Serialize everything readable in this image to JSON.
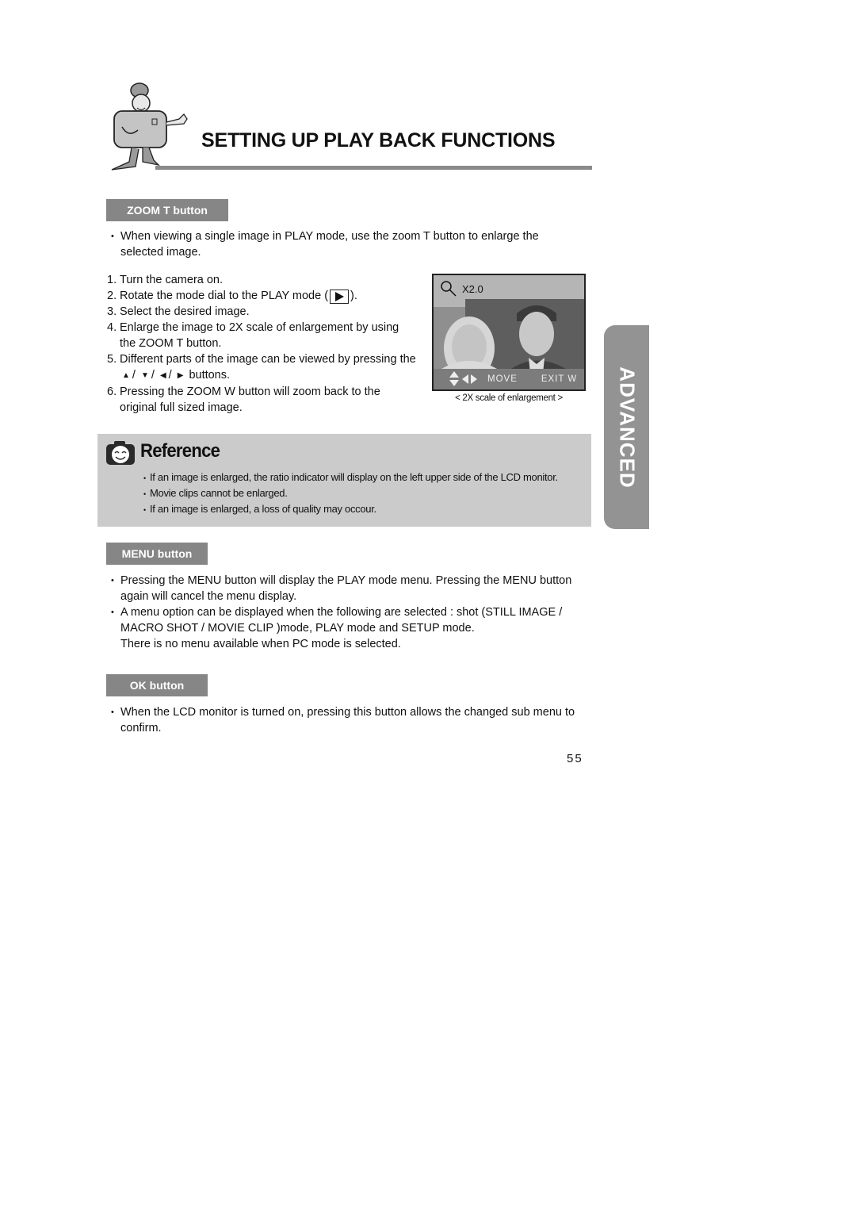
{
  "header": {
    "title": "SETTING UP PLAY BACK FUNCTIONS",
    "mascot_icon": "camera-mascot-icon"
  },
  "zoom_t": {
    "tag": "ZOOM T button",
    "intro_line1": "When viewing a single image in PLAY mode, use the zoom T button to enlarge the",
    "intro_line2": "selected image.",
    "steps": [
      {
        "num": "1.",
        "lines": [
          "Turn the camera on."
        ]
      },
      {
        "num": "2.",
        "pre": "Rotate the mode dial to the PLAY mode (",
        "post": ")."
      },
      {
        "num": "3.",
        "lines": [
          "Select the desired image."
        ]
      },
      {
        "num": "4.",
        "lines": [
          "Enlarge the image to 2X scale of enlargement by using",
          "the ZOOM T button."
        ]
      },
      {
        "num": "5.",
        "lines": [
          "Different parts of the image can be viewed by pressing the"
        ],
        "arrows_suffix": "buttons."
      },
      {
        "num": "6.",
        "lines": [
          "Pressing the ZOOM W button will zoom back to the",
          "original full sized image."
        ]
      }
    ],
    "arrow_separator": "/",
    "lcd": {
      "zoom_indicator": "X2.0",
      "move_label": "MOVE",
      "exit_label": "EXIT W",
      "caption": "< 2X scale of enlargement >"
    }
  },
  "reference": {
    "title": "Reference",
    "items": [
      "If an image is enlarged, the ratio indicator will display on the left upper side of the LCD monitor.",
      "Movie clips cannot be enlarged.",
      "If an image is enlarged, a loss of quality may occour."
    ]
  },
  "menu": {
    "tag": "MENU button",
    "bullet1_line1": "Pressing the MENU button will display the PLAY mode menu. Pressing the MENU button",
    "bullet1_line2": "again will cancel the menu display.",
    "bullet2_line1": "A menu option can be displayed when the following are selected : shot (STILL IMAGE /",
    "bullet2_line2": "MACRO SHOT / MOVIE CLIP )mode, PLAY mode and SETUP mode.",
    "bullet2_line3": "There is no menu available when PC mode is selected."
  },
  "ok": {
    "tag": "OK button",
    "line1": "When the LCD monitor is turned on, pressing this button allows the changed sub menu to",
    "line2": "confirm."
  },
  "side_tab": "ADVANCED",
  "page_number": "55"
}
